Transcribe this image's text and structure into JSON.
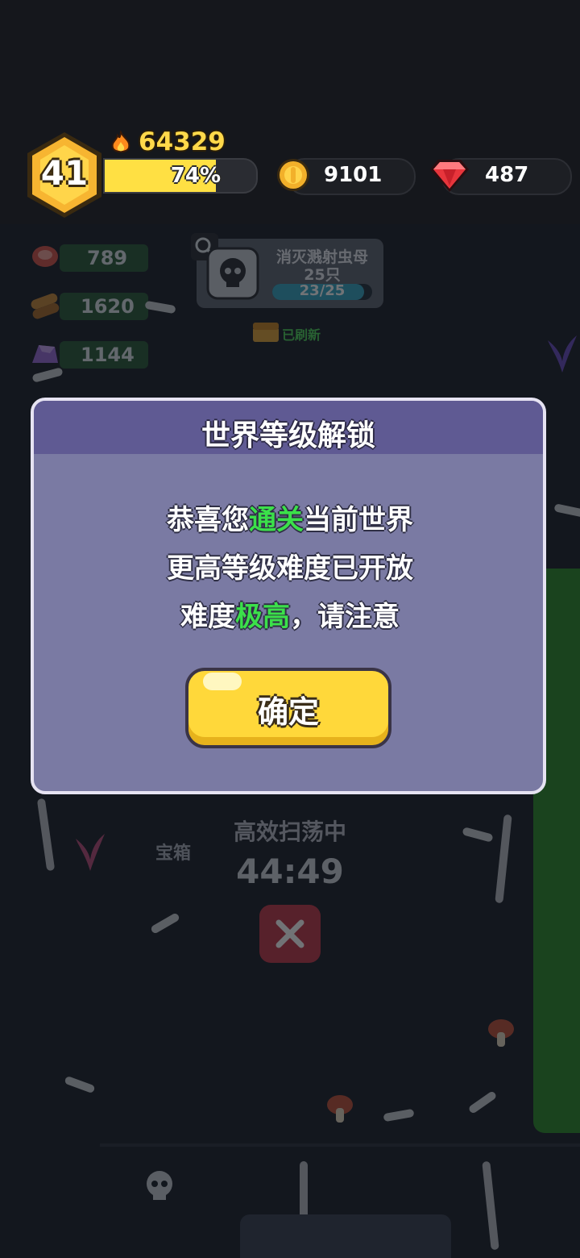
{
  "hud": {
    "level": "41",
    "power": "64329",
    "xp_percent_label": "74%",
    "xp_fraction": 0.74,
    "coins": "9101",
    "gems": "487",
    "icons": [
      "flame-icon",
      "coin-icon",
      "gem-icon"
    ]
  },
  "world": {
    "materials": [
      {
        "icon": "meat-icon",
        "value": "789"
      },
      {
        "icon": "wood-icon",
        "value": "1620"
      },
      {
        "icon": "ore-icon",
        "value": "1144"
      }
    ],
    "mission": {
      "title_line1": "消灭溅射虫母",
      "title_line2": "25只",
      "progress": "23/25",
      "progress_fraction": 0.92
    },
    "refreshed_label": "已刷新",
    "chest_label": "宝箱",
    "sweep_label": "高效扫荡中",
    "sweep_timer": "44:49"
  },
  "dialog": {
    "title": "世界等级解锁",
    "line1_a": "恭喜您",
    "line1_hl": "通关",
    "line1_b": "当前世界",
    "line2": "更高等级难度已开放",
    "line3_a": "难度",
    "line3_hl": "极高",
    "line3_b": "，请注意",
    "confirm": "确定"
  },
  "colors": {
    "highlight_green": "#3be04a",
    "button_yellow": "#ffd83a",
    "dialog_bg": "#7a7aa3",
    "dialog_header": "#5f5a93"
  }
}
